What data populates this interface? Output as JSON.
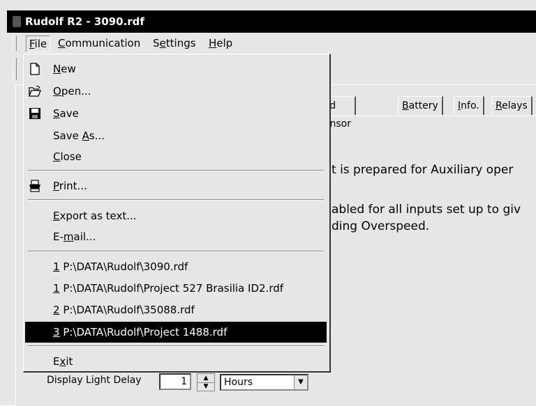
{
  "window": {
    "title": "Rudolf R2 - 3090.rdf"
  },
  "menubar": {
    "file": {
      "ul": "F",
      "rest": "ile"
    },
    "communication": {
      "ul": "C",
      "rest": "ommunication"
    },
    "settings": {
      "pre": "S",
      "ul": "e",
      "rest": "ttings"
    },
    "help": {
      "ul": "H",
      "rest": "elp"
    }
  },
  "tabs": [
    {
      "pre": "eed Sensor",
      "ul": "",
      "rest": ""
    },
    {
      "pre": "",
      "ul": "B",
      "rest": "attery"
    },
    {
      "pre": "",
      "ul": "I",
      "rest": "nfo."
    },
    {
      "pre": "",
      "ul": "R",
      "rest": "elays"
    }
  ],
  "panel": {
    "line1": "t is prepared for Auxiliary oper",
    "line2": "abled for all inputs set up to giv",
    "line3": "ding Overspeed."
  },
  "display_light": {
    "label": "Display Light Delay",
    "value": "1",
    "unit": "Hours"
  },
  "file_menu": {
    "new": {
      "ul": "N",
      "rest": "ew",
      "icon": "new-document-icon"
    },
    "open": {
      "ul": "O",
      "rest": "pen...",
      "icon": "open-folder-icon"
    },
    "save": {
      "ul": "S",
      "rest": "ave",
      "icon": "floppy-disk-icon"
    },
    "save_as": {
      "pre": "Save ",
      "ul": "A",
      "rest": "s..."
    },
    "close": {
      "ul": "C",
      "rest": "lose"
    },
    "print": {
      "ul": "P",
      "rest": "rint...",
      "icon": "printer-icon"
    },
    "export": {
      "ul": "E",
      "rest": "xport as text..."
    },
    "email": {
      "pre": "E-",
      "ul": "m",
      "rest": "ail..."
    },
    "recent": [
      {
        "ul": "1",
        "rest": " P:\\DATA\\Rudolf\\3090.rdf"
      },
      {
        "ul": "1",
        "rest": " P:\\DATA\\Rudolf\\Project 527 Brasilia ID2.rdf"
      },
      {
        "ul": "2",
        "rest": " P:\\DATA\\Rudolf\\35088.rdf"
      },
      {
        "ul": "3",
        "rest": " P:\\DATA\\Rudolf\\Project 1488.rdf"
      }
    ],
    "exit": {
      "pre": "E",
      "ul": "x",
      "rest": "it"
    }
  }
}
